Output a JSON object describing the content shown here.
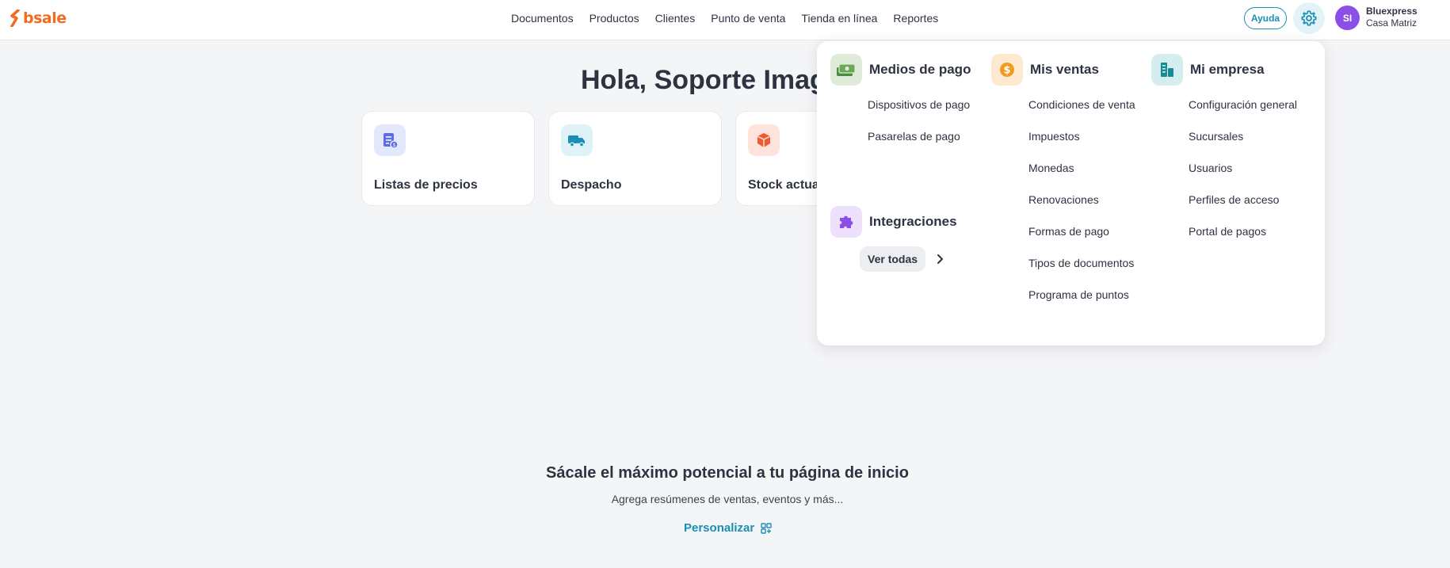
{
  "brand": {
    "logo_text": "bsale",
    "color": "#f26b21"
  },
  "nav": {
    "items": [
      "Documentos",
      "Productos",
      "Clientes",
      "Punto de venta",
      "Tienda en línea",
      "Reportes"
    ]
  },
  "header": {
    "help_label": "Ayuda",
    "avatar_initials": "SI",
    "company_name": "Bluexpress",
    "company_branch": "Casa Matriz"
  },
  "main": {
    "greeting": "Hola, Soporte Imag",
    "cards": [
      {
        "label": "Listas de precios",
        "icon": "price-list-icon"
      },
      {
        "label": "Despacho",
        "icon": "truck-icon"
      },
      {
        "label": "Stock actua",
        "icon": "box-icon"
      }
    ]
  },
  "promo": {
    "title": "Sácale el máximo potencial a tu página de inicio",
    "subtitle": "Agrega resúmenes de ventas, eventos y más...",
    "link_label": "Personalizar"
  },
  "settings_menu": {
    "payment": {
      "title": "Medios de pago",
      "items": [
        "Dispositivos de pago",
        "Pasarelas de pago"
      ]
    },
    "integrations": {
      "title": "Integraciones",
      "see_all_label": "Ver todas"
    },
    "sales": {
      "title": "Mis ventas",
      "items": [
        "Condiciones de venta",
        "Impuestos",
        "Monedas",
        "Renovaciones",
        "Formas de pago",
        "Tipos de documentos",
        "Programa de puntos"
      ]
    },
    "company": {
      "title": "Mi empresa",
      "items": [
        "Configuración general",
        "Sucursales",
        "Usuarios",
        "Perfiles de acceso",
        "Portal de pagos"
      ]
    }
  },
  "colors": {
    "accent": "#1a8fb5",
    "avatar": "#8b4ee6",
    "text": "#2d3340"
  }
}
